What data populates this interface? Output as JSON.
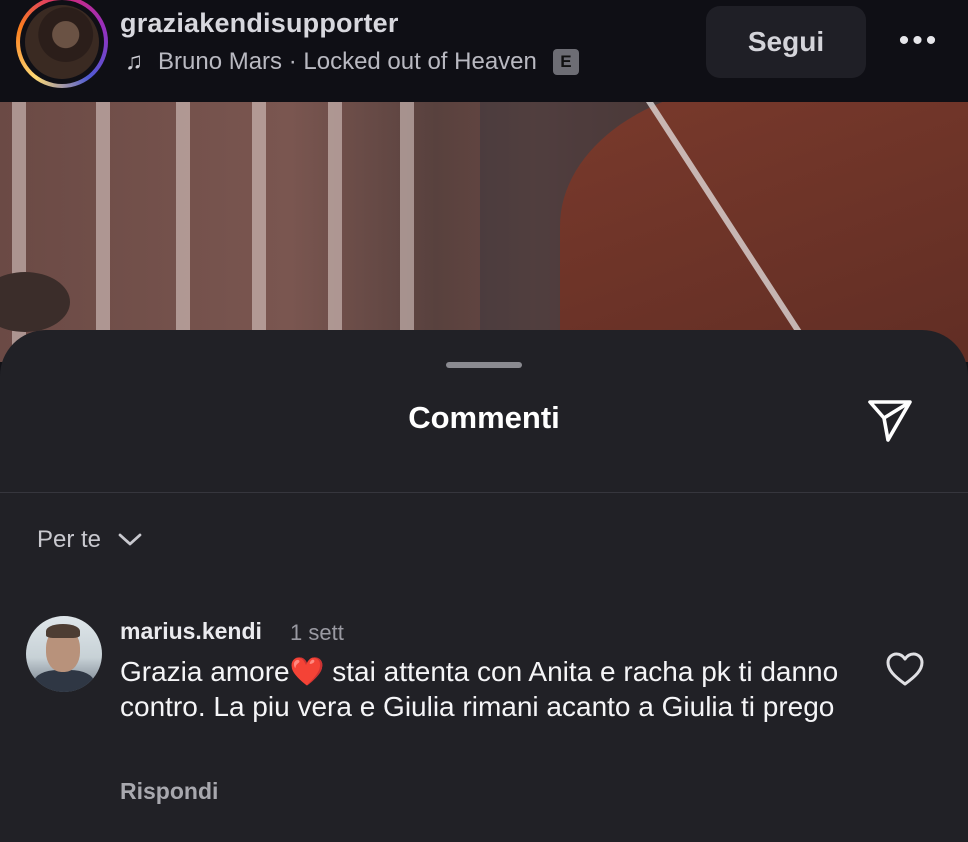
{
  "header": {
    "username": "graziakendisupporter",
    "music_icon": "♫",
    "music_text": "Bruno Mars · Locked out of Heaven",
    "explicit_badge": "E",
    "follow_label": "Segui",
    "more_label": "•••"
  },
  "comments_sheet": {
    "title": "Commenti",
    "filter_label": "Per te",
    "comments": [
      {
        "username": "marius.kendi",
        "time": "1 sett",
        "text_before_emoji": "Grazia amore",
        "emoji": "❤️",
        "text_after_emoji": "  stai attenta con Anita e racha pk ti danno contro.  La piu vera e Giulia rimani acanto a Giulia ti prego",
        "reply_label": "Rispondi"
      }
    ]
  },
  "colors": {
    "sheet_background": "#212126",
    "header_background": "#0f0f15",
    "heart": "#e8262e"
  }
}
